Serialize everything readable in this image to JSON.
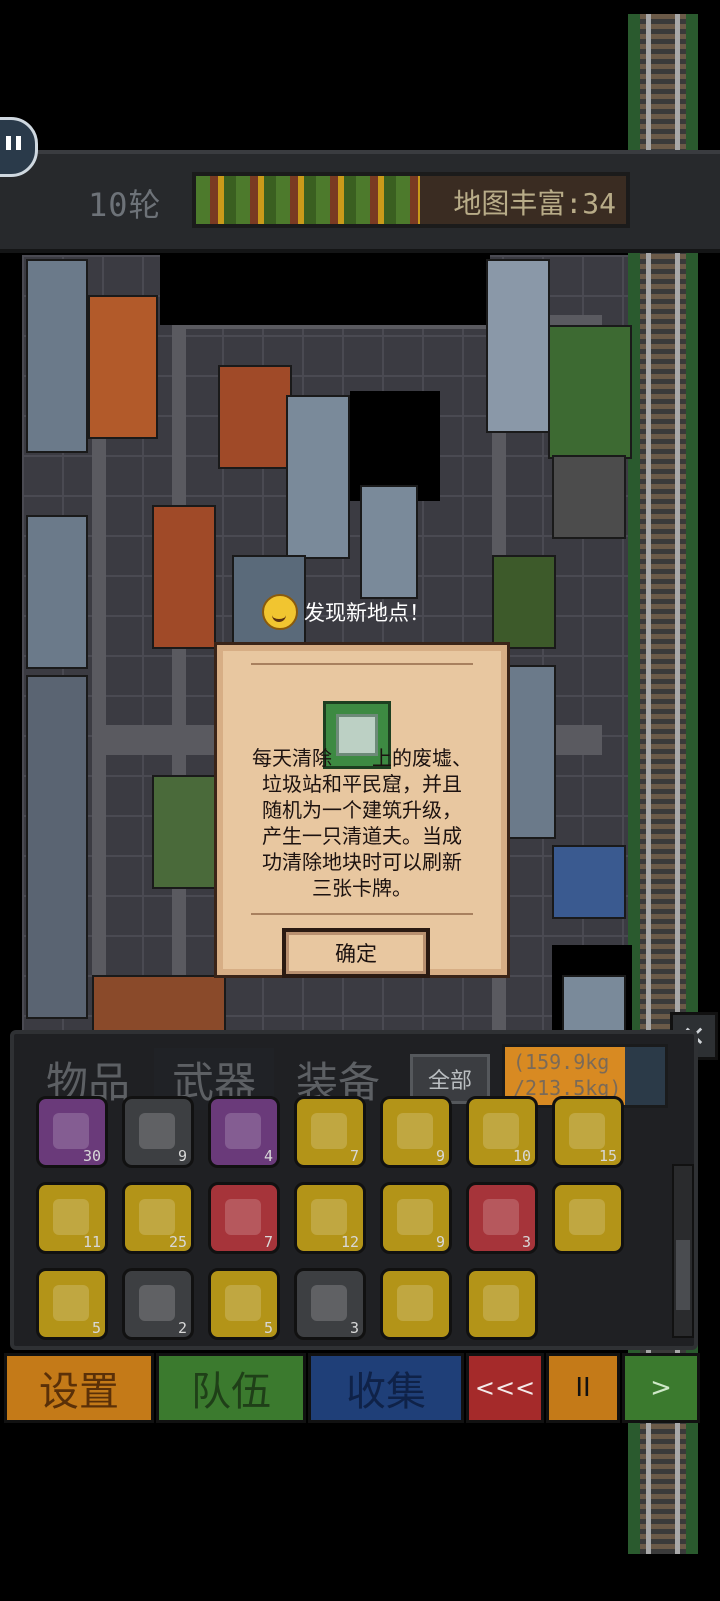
{
  "hud": {
    "round_label": "10轮",
    "map_label": "地图丰富:34",
    "map_richness_fraction": 0.52,
    "pause_icon": "pause-icon"
  },
  "popup": {
    "heading": "发现新地点！",
    "icon": "card-building-icon",
    "description": "每天清除　　上的废墟、\n垃圾站和平民窟，并且\n随机为一个建筑升级，\n产生一只清道夫。当成\n功清除地块时可以刷新\n三张卡牌。",
    "confirm_label": "确定"
  },
  "inventory": {
    "tabs": [
      {
        "label": "物品"
      },
      {
        "label": "武器"
      },
      {
        "label": "装备"
      }
    ],
    "filter_label": "全部",
    "weight_text": "(159.9kg\n/213.5kg)",
    "weight_fraction": 0.75,
    "rows": [
      [
        {
          "count": "30",
          "color": "p"
        },
        {
          "count": "9",
          "color": "g"
        },
        {
          "count": "4",
          "color": "p"
        },
        {
          "count": "7",
          "color": "y"
        },
        {
          "count": "9",
          "color": "y"
        },
        {
          "count": "10",
          "color": "y"
        },
        {
          "count": "15",
          "color": "y"
        }
      ],
      [
        {
          "count": "11",
          "color": "y"
        },
        {
          "count": "25",
          "color": "y"
        },
        {
          "count": "7",
          "color": "r"
        },
        {
          "count": "12",
          "color": "y"
        },
        {
          "count": "9",
          "color": "y"
        },
        {
          "count": "3",
          "color": "r"
        },
        {
          "count": "",
          "color": "y"
        }
      ],
      [
        {
          "count": "5",
          "color": "y"
        },
        {
          "count": "2",
          "color": "g"
        },
        {
          "count": "5",
          "color": "y"
        },
        {
          "count": "3",
          "color": "g"
        },
        {
          "count": "",
          "color": "y"
        },
        {
          "count": "",
          "color": "y"
        }
      ]
    ]
  },
  "bottom_bar": {
    "settings_label": "设置",
    "team_label": "队伍",
    "collect_label": "收集",
    "rewind_label": "<<<",
    "pause_label": "II",
    "play_label": ">"
  },
  "colors": {
    "settings": "#c47a18",
    "team": "#3b7a2e",
    "collect": "#1f3f78",
    "rewind": "#a52a2a",
    "pause": "#c47a18",
    "play": "#3b7a2e"
  }
}
